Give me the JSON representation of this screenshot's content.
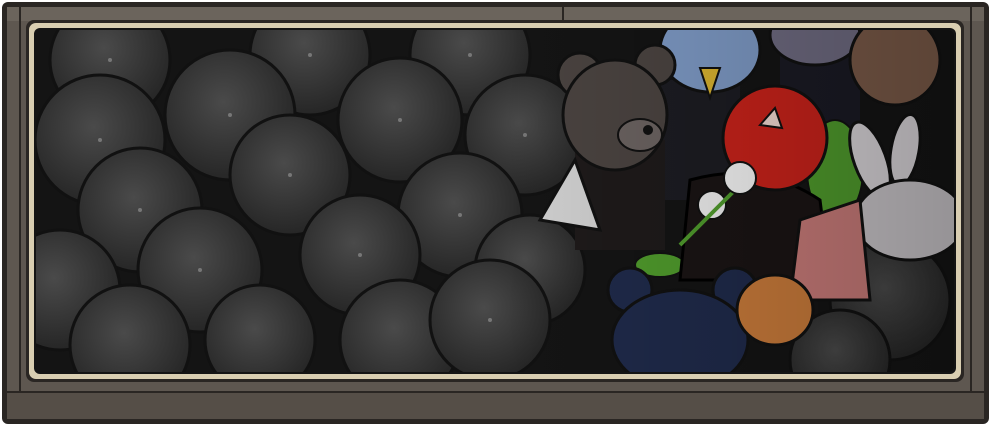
{
  "scene": {
    "description_label": "",
    "colors": {
      "frame": "#5e5750",
      "frame_dark": "#2a2623",
      "inner_border": "#d9ceb1",
      "background": "#141414",
      "umbrella": "#3a3a3a",
      "red_head": "#c8221a",
      "bear": "#4a4340",
      "bird": "#7d99c4",
      "navy_bear": "#1f2a4a",
      "leaves": "#4f9a2c"
    }
  }
}
